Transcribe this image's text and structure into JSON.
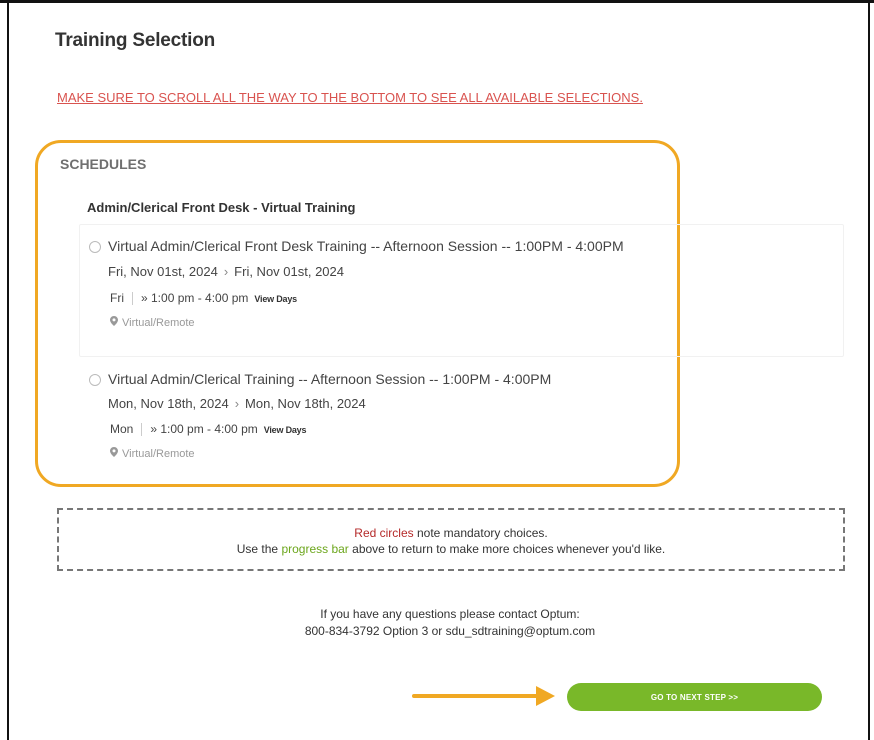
{
  "page": {
    "title": "Training Selection",
    "warning": "MAKE SURE TO SCROLL ALL THE WAY TO THE BOTTOM TO SEE ALL AVAILABLE SELECTIONS."
  },
  "schedules": {
    "label": "SCHEDULES",
    "group_title": "Admin/Clerical Front Desk - Virtual Training",
    "options": [
      {
        "title": "Virtual Admin/Clerical Front Desk Training -- Afternoon Session -- 1:00PM - 4:00PM",
        "start_date": "Fri, Nov 01st, 2024",
        "end_date": "Fri, Nov 01st, 2024",
        "day": "Fri",
        "time": "» 1:00 pm - 4:00 pm",
        "view_days": "View Days",
        "location": "Virtual/Remote"
      },
      {
        "title": "Virtual Admin/Clerical Training -- Afternoon Session -- 1:00PM - 4:00PM",
        "start_date": "Mon, Nov 18th, 2024",
        "end_date": "Mon, Nov 18th, 2024",
        "day": "Mon",
        "time": "» 1:00 pm - 4:00 pm",
        "view_days": "View Days",
        "location": "Virtual/Remote"
      }
    ]
  },
  "notes": {
    "line1_highlight": "Red circles",
    "line1_rest": " note mandatory choices.",
    "line2_pre": "Use the ",
    "line2_highlight": "progress bar",
    "line2_post": " above to return to make more choices whenever you'd like."
  },
  "contact": {
    "line1": "If you have any questions please contact Optum:",
    "line2": "800-834-3792 Option 3 or sdu_sdtraining@optum.com"
  },
  "next_button": "GO TO NEXT STEP >>",
  "colors": {
    "accent_orange": "#f0a823",
    "warning_red": "#d9534f",
    "button_green": "#79b829",
    "note_red": "#b52a2a",
    "note_green": "#6ca61c"
  },
  "icons": {
    "chevron": "chevron-right-icon",
    "pin": "map-pin-icon",
    "arrow": "arrow-right-icon"
  }
}
